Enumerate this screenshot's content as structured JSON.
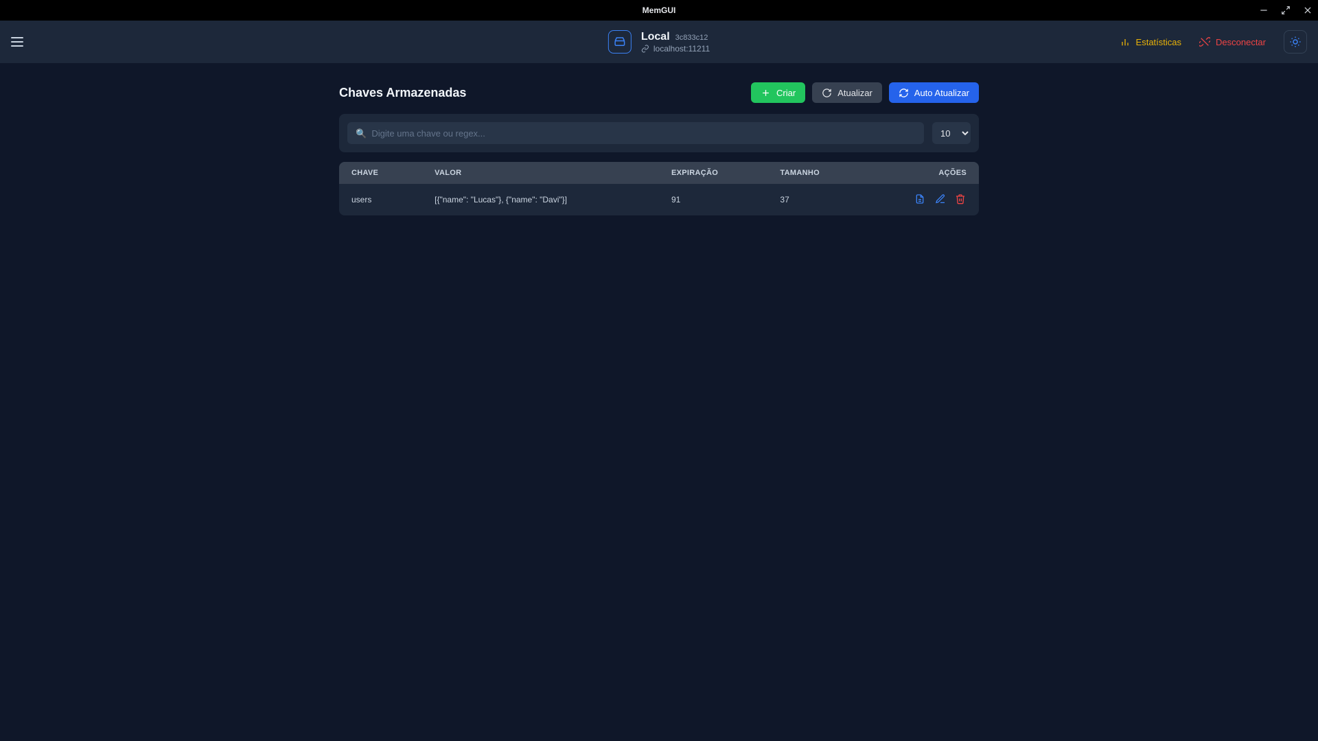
{
  "titlebar": {
    "title": "MemGUI"
  },
  "header": {
    "server_name": "Local",
    "server_hash": "3c833c12",
    "server_host": "localhost:11211",
    "stats_label": "Estatísticas",
    "disconnect_label": "Desconectar"
  },
  "page": {
    "title": "Chaves Armazenadas",
    "create_label": "Criar",
    "refresh_label": "Atualizar",
    "autorefresh_label": "Auto Atualizar",
    "search_placeholder": "🔍  Digite uma chave ou regex...",
    "page_size_value": "10"
  },
  "columns": {
    "chave": "CHAVE",
    "valor": "VALOR",
    "expiracao": "EXPIRAÇÃO",
    "tamanho": "TAMANHO",
    "acoes": "AÇÕES"
  },
  "rows": [
    {
      "chave": "users",
      "valor": "[{\"name\": \"Lucas\"}, {\"name\": \"Davi\"}]",
      "expiracao": "91",
      "tamanho": "37"
    }
  ]
}
